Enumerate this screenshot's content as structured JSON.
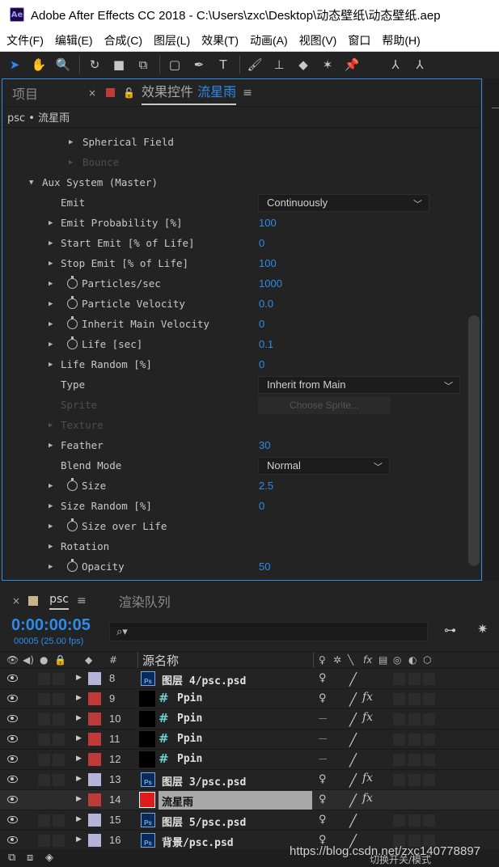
{
  "window": {
    "title": "Adobe After Effects CC 2018 - C:\\Users\\zxc\\Desktop\\动态壁纸\\动态壁纸.aep",
    "logo": "Ae"
  },
  "menu": [
    "文件(F)",
    "编辑(E)",
    "合成(C)",
    "图层(L)",
    "效果(T)",
    "动画(A)",
    "视图(V)",
    "窗口",
    "帮助(H)"
  ],
  "toolbar": {
    "tools": [
      "selection-tool-icon",
      "hand-tool-icon",
      "zoom-tool-icon",
      "rotate-tool-icon",
      "camera-tool-icon",
      "pan-behind-icon",
      "rectangle-tool-icon",
      "pen-tool-icon",
      "type-tool-icon",
      "brush-tool-icon",
      "clone-stamp-icon",
      "eraser-tool-icon",
      "roto-brush-icon",
      "puppet-pin-icon",
      "axis-local-icon",
      "axis-world-icon"
    ],
    "glyphs": [
      "➤",
      "✋",
      "🔍",
      "↻",
      "■",
      "⧉",
      "▢",
      "✒",
      "T",
      "🖌",
      "⊥",
      "◆",
      "✶",
      "📌",
      "⅄",
      "⅄"
    ]
  },
  "effect_controls": {
    "project_tab": "项目",
    "close": "×",
    "lock": "🔓",
    "title_prefix": "效果控件",
    "title_layer": "流星雨",
    "menu": "≡",
    "breadcrumb": "psc • 流星雨",
    "rows": [
      {
        "label": "Spherical Field",
        "indent": 3,
        "dim": false
      },
      {
        "label": "Bounce",
        "indent": 3,
        "dim": true
      },
      {
        "label": "Aux System (Master)",
        "indent": 1,
        "expanded": true
      },
      {
        "label": "Emit",
        "indent": 2,
        "no_tri": true,
        "dropdown": "Continuously",
        "dropdown_width": 212
      },
      {
        "label": "Emit Probability [%]",
        "indent": 2,
        "value": "100"
      },
      {
        "label": "Start Emit [% of Life]",
        "indent": 2,
        "value": "0"
      },
      {
        "label": "Stop Emit [% of Life]",
        "indent": 2,
        "value": "100"
      },
      {
        "label": "Particles/sec",
        "indent": 2,
        "stopwatch": true,
        "value": "1000"
      },
      {
        "label": "Particle Velocity",
        "indent": 2,
        "stopwatch": true,
        "value": "0.0"
      },
      {
        "label": "Inherit Main Velocity",
        "indent": 2,
        "stopwatch": true,
        "value": "0"
      },
      {
        "label": "Life [sec]",
        "indent": 2,
        "stopwatch": true,
        "value": "0.1"
      },
      {
        "label": "Life Random [%]",
        "indent": 2,
        "value": "0"
      },
      {
        "label": "Type",
        "indent": 2,
        "no_tri": true,
        "dropdown": "Inherit from Main",
        "dropdown_width": 250
      },
      {
        "label": "Sprite",
        "indent": 2,
        "no_tri": true,
        "dim": true,
        "button": "Choose Sprite..."
      },
      {
        "label": "Texture",
        "indent": 2,
        "dim": true
      },
      {
        "label": "Feather",
        "indent": 2,
        "value": "30"
      },
      {
        "label": "Blend Mode",
        "indent": 2,
        "no_tri": true,
        "dropdown": "Normal",
        "dropdown_width": 163
      },
      {
        "label": "Size",
        "indent": 2,
        "stopwatch": true,
        "value": "2.5"
      },
      {
        "label": "Size Random [%]",
        "indent": 2,
        "value": "0"
      },
      {
        "label": "Size over Life",
        "indent": 2,
        "stopwatch": true
      },
      {
        "label": "Rotation",
        "indent": 2
      },
      {
        "label": "Opacity",
        "indent": 2,
        "stopwatch": true,
        "value": "50"
      }
    ]
  },
  "timeline": {
    "close": "×",
    "comp_tab": "psc",
    "menu": "≡",
    "render_queue": "渲染队列",
    "timecode": "0:00:00:05",
    "frames": "00005 (25.00 fps)",
    "search_placeholder": "⌕▾",
    "header": {
      "number": "#",
      "source_name": "源名称",
      "fx": "fx"
    },
    "layers": [
      {
        "num": "8",
        "color": "#b4b4d8",
        "kind": "psd",
        "name": "图层 4/psc.psd",
        "fx": false,
        "mode": "switch"
      },
      {
        "num": "9",
        "color": "#c03a3a",
        "kind": "solid",
        "name": "Ppin",
        "fx": true,
        "mode": "switch"
      },
      {
        "num": "10",
        "color": "#c03a3a",
        "kind": "solid",
        "name": "Ppin",
        "fx": true,
        "mode": "flat"
      },
      {
        "num": "11",
        "color": "#c03a3a",
        "kind": "solid",
        "name": "Ppin",
        "fx": false,
        "mode": "flat"
      },
      {
        "num": "12",
        "color": "#c03a3a",
        "kind": "solid",
        "name": "Ppin",
        "fx": false,
        "mode": "flat"
      },
      {
        "num": "13",
        "color": "#b4b4d8",
        "kind": "psd",
        "name": "图层 3/psc.psd",
        "fx": true,
        "mode": "switch"
      },
      {
        "num": "14",
        "color": "#c03a3a",
        "kind": "red",
        "name": "流星雨",
        "fx": true,
        "mode": "switch",
        "selected": true
      },
      {
        "num": "15",
        "color": "#b4b4d8",
        "kind": "psd",
        "name": "图层 5/psc.psd",
        "fx": false,
        "mode": "switch"
      },
      {
        "num": "16",
        "color": "#b4b4d8",
        "kind": "psd",
        "name": "背景/psc.psd",
        "fx": false,
        "mode": "switch"
      }
    ],
    "mode_toggle": "切换开关/模式"
  },
  "watermark": "https://blog.csdn.net/zxc140778897",
  "colors": {
    "accent": "#2d8ceb",
    "label_red": "#c03a3a",
    "label_lavender": "#b4b4d8"
  }
}
